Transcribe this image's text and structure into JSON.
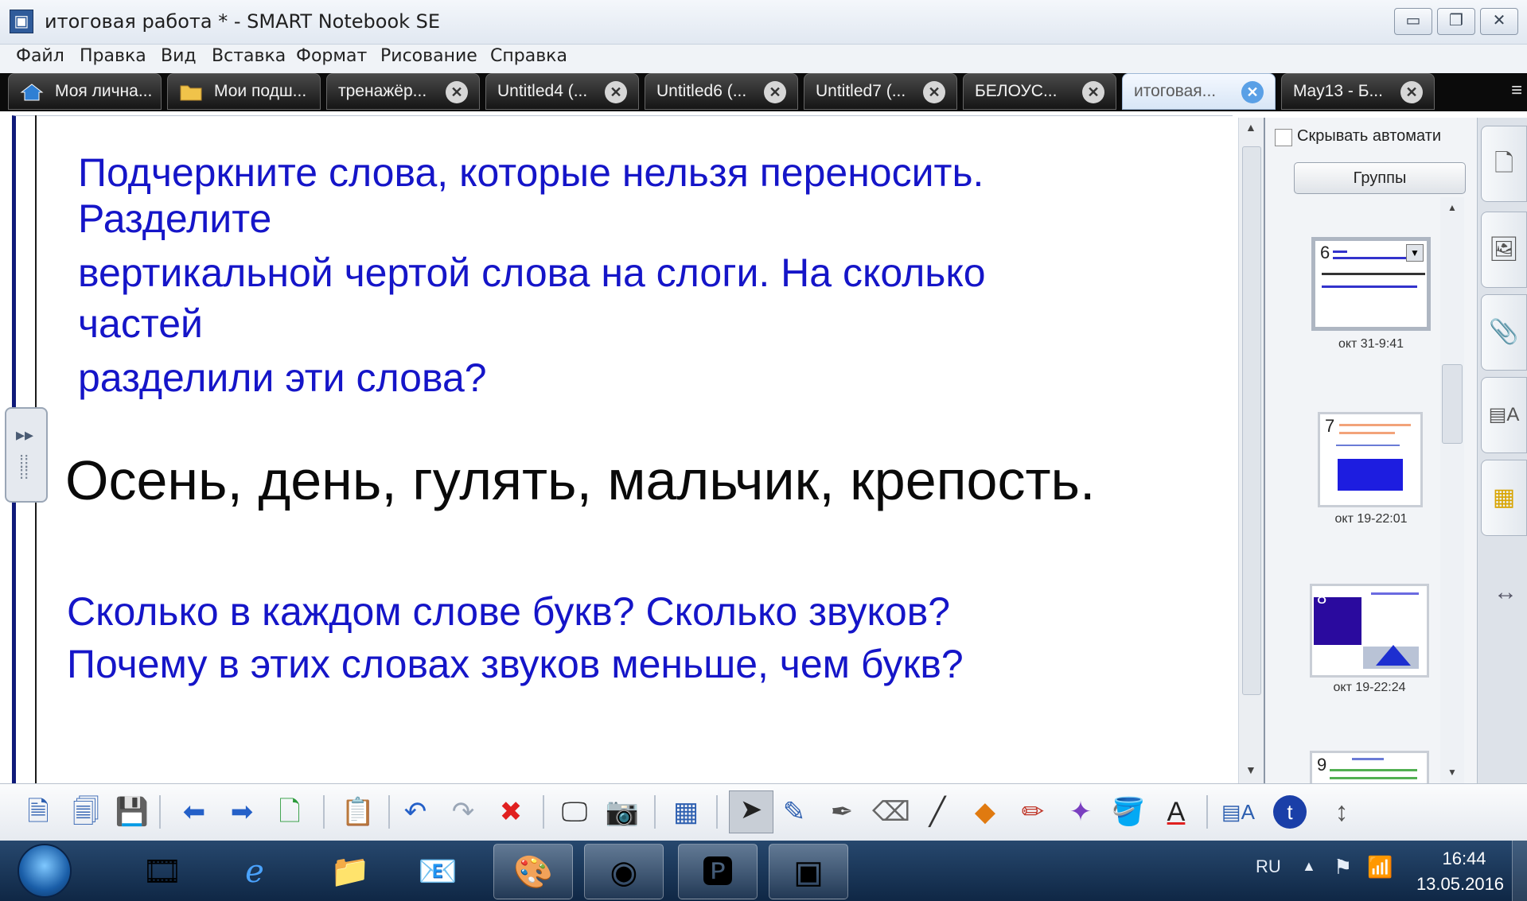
{
  "window": {
    "title": "итоговая работа * - SMART Notebook SE",
    "minimize_glyph": "▭",
    "restore_glyph": "❐",
    "close_glyph": "✕"
  },
  "menu": [
    "Файл",
    "Правка",
    "Вид",
    "Вставка",
    "Формат",
    "Рисование",
    "Справка"
  ],
  "tabs": [
    {
      "label": "Моя лична...",
      "icon": "house-icon"
    },
    {
      "label": "Мои подш...",
      "icon": "folder-icon"
    },
    {
      "label": "тренажёр...",
      "closable": true
    },
    {
      "label": "Untitled4 (...",
      "closable": true
    },
    {
      "label": "Untitled6 (...",
      "closable": true
    },
    {
      "label": "Untitled7 (...",
      "closable": true
    },
    {
      "label": "БЕЛОУС...",
      "closable": true
    },
    {
      "label": "итоговая...",
      "closable": true,
      "active": true
    },
    {
      "label": "May13 - Б...",
      "closable": true
    }
  ],
  "page": {
    "instruction_lines": [
      "Подчеркните слова, которые нельзя переносить.",
      "Разделите",
      "вертикальной чертой слова на слоги. На сколько",
      "частей",
      "разделили эти слова?"
    ],
    "words_line": "Осень, день, гулять, мальчик, крепость.",
    "question_lines": [
      "Сколько в каждом слове букв? Сколько звуков?",
      "Почему в этих словах звуков меньше, чем букв?"
    ]
  },
  "sorter": {
    "autohide_label": "Скрывать автомати",
    "groups_label": "Группы",
    "thumbnails": [
      {
        "number": "6",
        "date": "окт 31-9:41",
        "selected": true
      },
      {
        "number": "7",
        "date": "окт 19-22:01"
      },
      {
        "number": "8",
        "date": "окт 19-22:24"
      },
      {
        "number": "9",
        "date": ""
      }
    ]
  },
  "taskbar": {
    "language": "RU",
    "time": "16:44",
    "date": "13.05.2016"
  },
  "colors": {
    "text_blue": "#1515c8",
    "text_black": "#0a0a0a",
    "canvas_border": "#0f1a7a",
    "tab_active_close": "#5aa0e6"
  }
}
